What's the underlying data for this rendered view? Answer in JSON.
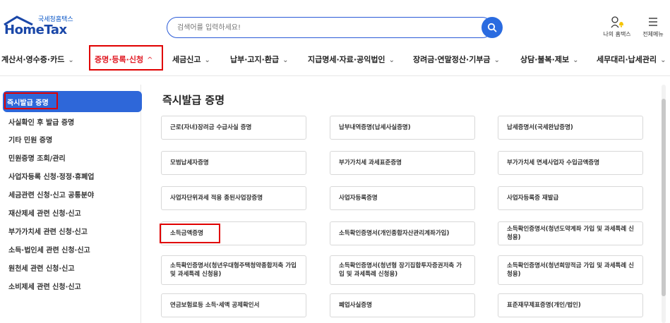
{
  "header": {
    "logo_sub": "국세청홈택스",
    "logo_main": "HomeTax",
    "search_placeholder": "검색어를 입력하세요!",
    "my_home_label": "나의 홈택스",
    "all_menu_label": "전체메뉴"
  },
  "nav": {
    "items": [
      {
        "label": "계산서·영수증·카드"
      },
      {
        "label": "증명·등록·신청"
      },
      {
        "label": "세금신고"
      },
      {
        "label": "납부·고지·환급"
      },
      {
        "label": "지급명세·자료·공익법인"
      },
      {
        "label": "장려금·연말정산·기부금"
      },
      {
        "label": "상담·불복·제보"
      },
      {
        "label": "세무대리·납세관리"
      }
    ],
    "active_index": 1
  },
  "sidebar": {
    "items": [
      {
        "label": "즉시발급 증명"
      },
      {
        "label": "사실확인 후 발급 증명"
      },
      {
        "label": "기타 민원 증명"
      },
      {
        "label": "민원증명 조회/관리"
      },
      {
        "label": "사업자등록 신청·정정·휴폐업"
      },
      {
        "label": "세금관련 신청·신고 공통분야"
      },
      {
        "label": "재산제세 관련 신청·신고"
      },
      {
        "label": "부가가치세 관련 신청·신고"
      },
      {
        "label": "소득·법인세 관련 신청·신고"
      },
      {
        "label": "원천세 관련 신청·신고"
      },
      {
        "label": "소비제세 관련 신청·신고"
      }
    ],
    "active_index": 0
  },
  "main": {
    "title": "즉시발급 증명",
    "cards": [
      {
        "label": "근로(자녀)장려금 수급사실 증명"
      },
      {
        "label": "납부내역증명(납세사실증명)"
      },
      {
        "label": "납세증명서(국세완납증명)"
      },
      {
        "label": "모범납세자증명"
      },
      {
        "label": "부가가치세 과세표준증명"
      },
      {
        "label": "부가가치세 면세사업자 수입금액증명"
      },
      {
        "label": "사업자단위과세 적용 종된사업장증명"
      },
      {
        "label": "사업자등록증명"
      },
      {
        "label": "사업자등록증 재발급"
      },
      {
        "label": "소득금액증명"
      },
      {
        "label": "소득확인증명서(개인종합자산관리계좌가입)"
      },
      {
        "label": "소득확인증명서(청년도약계좌 가입 및 과세특례 신청용)"
      },
      {
        "label": "소득확인증명서(청년우대형주택청약종합저축 가입 및 과세특례 신청용)"
      },
      {
        "label": "소득확인증명서(청년형 장기집합투자증권저축 가입 및 과세특례 신청용)"
      },
      {
        "label": "소득확인증명서(청년희망적금 가입 및 과세특례 신청용)"
      },
      {
        "label": "연금보험료등 소득·세액 공제확인서"
      },
      {
        "label": "폐업사실증명"
      },
      {
        "label": "표준재무제표증명(개인/법인)"
      }
    ]
  },
  "colors": {
    "brand_blue": "#2e67d9",
    "highlight_red": "#e00000",
    "active_nav": "#e01b24"
  }
}
